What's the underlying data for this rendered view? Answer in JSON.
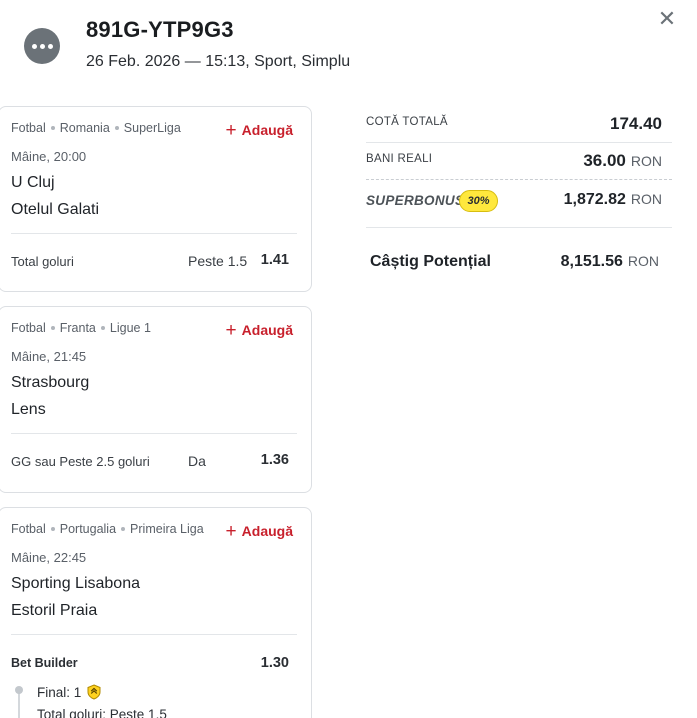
{
  "ticket": {
    "id": "891G-YTP9G3",
    "meta": "26 Feb. 2026 — 15:13, Sport, Simplu",
    "status_icon": "more-dots-icon"
  },
  "events": [
    {
      "sport": "Fotbal",
      "country": "Romania",
      "league": "SuperLiga",
      "add_label": "Adaugă",
      "time": "Mâine, 20:00",
      "home": "U Cluj",
      "away": "Otelul Galati",
      "market": "Total goluri",
      "pick": "Peste 1.5",
      "odd": "1.41"
    },
    {
      "sport": "Fotbal",
      "country": "Franta",
      "league": "Ligue 1",
      "add_label": "Adaugă",
      "time": "Mâine, 21:45",
      "home": "Strasbourg",
      "away": "Lens",
      "market": "GG sau Peste 2.5 goluri",
      "pick": "Da",
      "odd": "1.36"
    },
    {
      "sport": "Fotbal",
      "country": "Portugalia",
      "league": "Primeira Liga",
      "add_label": "Adaugă",
      "time": "Mâine, 22:45",
      "home": "Sporting Lisabona",
      "away": "Estoril Praia",
      "market": "Bet Builder",
      "odd": "1.30",
      "selections": [
        "Final: 1",
        "Total goluri: Peste 1.5"
      ]
    }
  ],
  "summary": {
    "total_odd_label": "Cotă totală",
    "total_odd": "174.40",
    "stake_label": "Bani reali",
    "stake": "36.00",
    "currency": "RON",
    "superbonus_label": "SUPERBONUS",
    "superbonus_pct": "30%",
    "superbonus_value": "1,872.82",
    "win_label": "Câștig Potențial",
    "win_value": "8,151.56"
  },
  "colors": {
    "accent_red": "#c8202c",
    "badge_yellow": "#ffe83d",
    "border": "#dcdfe3"
  }
}
